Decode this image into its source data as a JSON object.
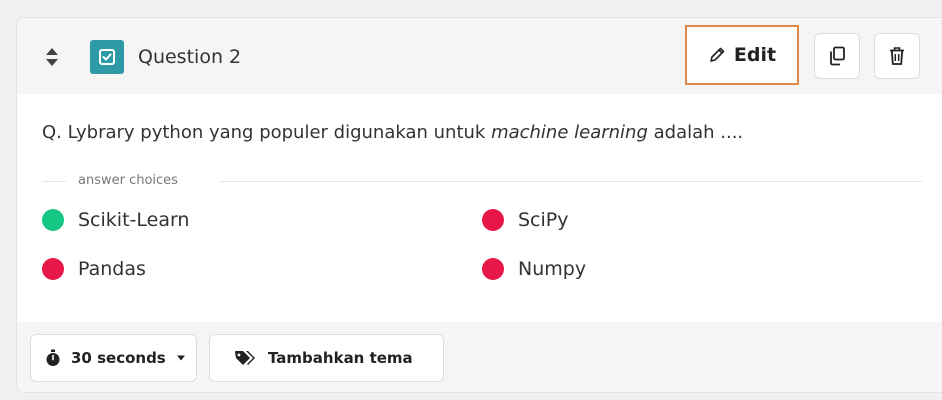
{
  "header": {
    "question_label": "Question 2",
    "edit_label": "Edit"
  },
  "question": {
    "prefix": "Q. Lybrary python yang populer digunakan untuk ",
    "emphasis": "machine learning",
    "suffix": " adalah ...."
  },
  "choices_label": "answer choices",
  "choices": [
    {
      "label": "Scikit-Learn",
      "correct": true
    },
    {
      "label": "SciPy",
      "correct": false
    },
    {
      "label": "Pandas",
      "correct": false
    },
    {
      "label": "Numpy",
      "correct": false
    }
  ],
  "footer": {
    "timer_label": "30 seconds",
    "theme_label": "Tambahkan tema"
  },
  "colors": {
    "correct": "#16c784",
    "incorrect": "#e8174a",
    "badge": "#2e9aa6",
    "edit_border": "#e08a49"
  },
  "icons": {
    "sort": "sort-updown-icon",
    "type": "checkbox-icon",
    "edit": "pencil-icon",
    "copy": "copy-icon",
    "delete": "trash-icon",
    "timer": "stopwatch-icon",
    "dropdown": "caret-down-icon",
    "theme": "tags-icon"
  }
}
